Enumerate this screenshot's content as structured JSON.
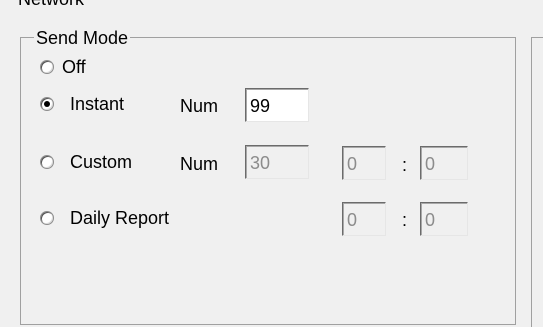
{
  "section_title": "Network",
  "send_mode": {
    "group_label": "Send Mode",
    "options": [
      {
        "label": "Off",
        "selected": false
      },
      {
        "label": "Instant",
        "selected": true
      },
      {
        "label": "Custom",
        "selected": false
      },
      {
        "label": "Daily Report",
        "selected": false
      }
    ],
    "instant": {
      "num_label": "Num",
      "num_value": "99"
    },
    "custom": {
      "num_label": "Num",
      "num_value": "30",
      "hour": "0",
      "separator": ":",
      "minute": "0"
    },
    "daily": {
      "hour": "0",
      "separator": ":",
      "minute": "0"
    }
  }
}
